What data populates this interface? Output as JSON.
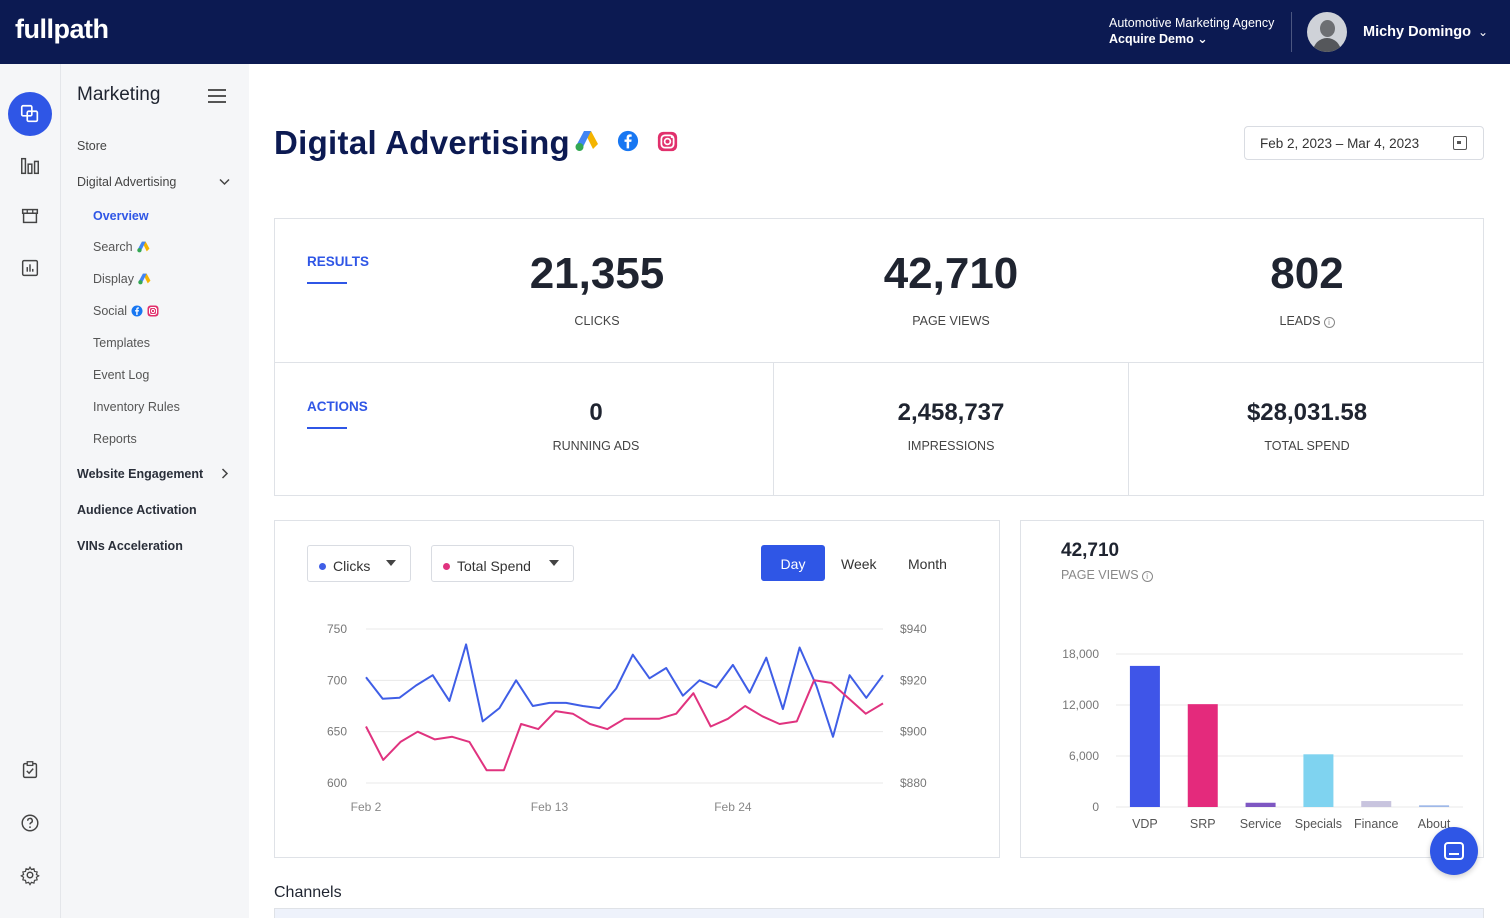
{
  "header": {
    "logo": "fullpath",
    "agency_name": "Automotive Marketing Agency",
    "account": "Acquire Demo ⌄",
    "user_name": "Michy Domingo",
    "user_chevron": "⌄"
  },
  "rail": {
    "top_icons": [
      "layers-icon",
      "bar-chart-icon",
      "store-icon",
      "report-icon"
    ],
    "bottom_icons": [
      "checklist-icon",
      "help-icon",
      "settings-icon"
    ]
  },
  "sidebar": {
    "title": "Marketing",
    "store": "Store",
    "digital_advertising": "Digital Advertising",
    "sub": {
      "overview": "Overview",
      "search": "Search",
      "display": "Display",
      "social": "Social",
      "templates": "Templates",
      "event_log": "Event Log",
      "inventory_rules": "Inventory Rules",
      "reports": "Reports"
    },
    "website_engagement": "Website Engagement",
    "audience_activation": "Audience Activation",
    "vins_acceleration": "VINs Acceleration"
  },
  "page": {
    "title": "Digital Advertising",
    "date_range": "Feb 2, 2023  –  Mar 4, 2023"
  },
  "results": {
    "label": "RESULTS",
    "clicks_value": "21,355",
    "clicks_label": "CLICKS",
    "page_views_value": "42,710",
    "page_views_label": "PAGE VIEWS",
    "leads_value": "802",
    "leads_label": "LEADS"
  },
  "actions": {
    "label": "ACTIONS",
    "running_ads_value": "0",
    "running_ads_label": "RUNNING ADS",
    "impressions_value": "2,458,737",
    "impressions_label": "IMPRESSIONS",
    "total_spend_value": "$28,031.58",
    "total_spend_label": "TOTAL SPEND"
  },
  "line_chart_controls": {
    "metric1": "Clicks",
    "metric1_color": "#3f5ee6",
    "metric2": "Total Spend",
    "metric2_color": "#e0337f",
    "granularity": [
      "Day",
      "Week",
      "Month"
    ],
    "selected": "Day"
  },
  "pageviews_card": {
    "value": "42,710",
    "label": "PAGE VIEWS"
  },
  "chart_data": [
    {
      "type": "line",
      "x_tick_labels": [
        "Feb 2",
        "Feb 13",
        "Feb 24"
      ],
      "y_left": {
        "ticks": [
          600,
          650,
          700,
          750
        ],
        "ylim": [
          600,
          750
        ]
      },
      "y_right": {
        "ticks": [
          "$880",
          "$900",
          "$920",
          "$940"
        ],
        "ylim": [
          880,
          940
        ]
      },
      "series": [
        {
          "name": "Clicks",
          "color": "#3f5ee6",
          "axis": "left",
          "values": [
            703,
            682,
            683,
            695,
            705,
            680,
            735,
            660,
            673,
            700,
            675,
            678,
            678,
            675,
            673,
            692,
            725,
            702,
            712,
            685,
            700,
            693,
            715,
            688,
            722,
            672,
            732,
            695,
            645,
            705,
            683,
            705
          ]
        },
        {
          "name": "Total Spend",
          "color": "#e0337f",
          "axis": "right",
          "values": [
            902,
            889,
            896,
            900,
            897,
            898,
            896,
            885,
            885,
            903,
            901,
            908,
            907,
            903,
            901,
            905,
            905,
            905,
            907,
            915,
            902,
            905,
            910,
            906,
            903,
            904,
            920,
            919,
            913,
            907,
            911
          ]
        }
      ],
      "grid": true
    },
    {
      "type": "bar",
      "categories": [
        "VDP",
        "SRP",
        "Service",
        "Specials",
        "Finance",
        "About"
      ],
      "values": [
        16600,
        12100,
        500,
        6200,
        700,
        200
      ],
      "colors": [
        "#3f55e8",
        "#e42a7c",
        "#7e57c2",
        "#7fd3f0",
        "#c8c4de",
        "#9fb8e8"
      ],
      "y_ticks": [
        0,
        6000,
        12000,
        18000
      ],
      "y_tick_labels": [
        "0",
        "6,000",
        "12,000",
        "18,000"
      ],
      "ylim": [
        0,
        18000
      ],
      "grid": true
    }
  ],
  "channels": {
    "title": "Channels"
  }
}
